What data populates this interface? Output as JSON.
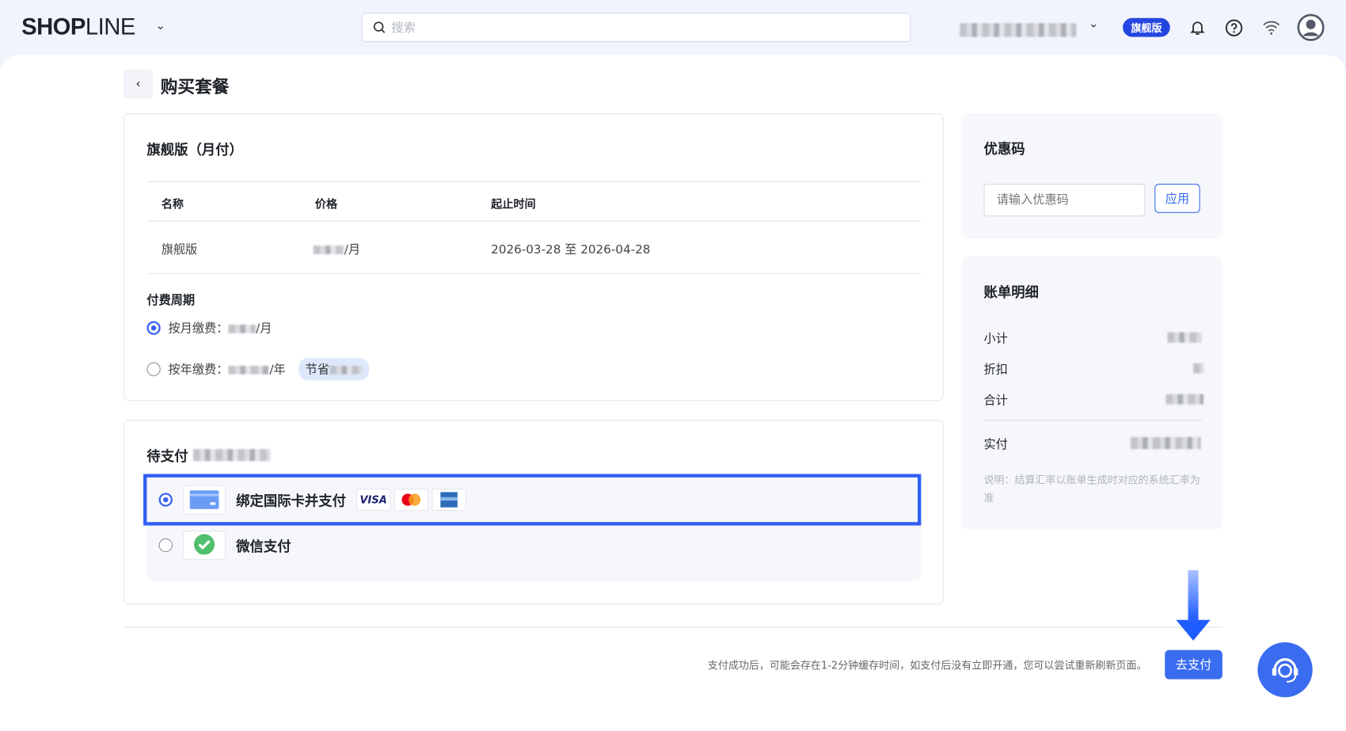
{
  "header": {
    "logo": {
      "bold": "SHOP",
      "thin": "LINE"
    },
    "search_placeholder": "搜索",
    "plan_badge": "旗舰版"
  },
  "page": {
    "title": "购买套餐"
  },
  "plan_card": {
    "title": "旗舰版（月付）",
    "columns": [
      "名称",
      "价格",
      "起止时间"
    ],
    "row": {
      "name": "旗舰版",
      "price_suffix": "/月",
      "period": "2026-03-28 至 2026-04-28"
    },
    "billing_cycle_label": "付费周期",
    "options": [
      {
        "label": "按月缴费：",
        "suffix": "/月",
        "selected": true
      },
      {
        "label": "按年缴费：",
        "suffix": "/年",
        "selected": false,
        "save_tag": "节省"
      }
    ]
  },
  "payment_card": {
    "title": "待支付",
    "methods": [
      {
        "label": "绑定国际卡并支付",
        "selected": true,
        "brands": [
          "VISA",
          "mastercard",
          "amex"
        ]
      },
      {
        "label": "微信支付",
        "selected": false
      }
    ]
  },
  "coupon": {
    "title": "优惠码",
    "placeholder": "请输入优惠码",
    "apply": "应用"
  },
  "bill": {
    "title": "账单明细",
    "items": [
      "小计",
      "折扣",
      "合计"
    ],
    "paid": "实付",
    "note": "说明：结算汇率以账单生成时对应的系统汇率为准"
  },
  "footer": {
    "notice": "支付成功后，可能会存在1-2分钟缓存时间，如支付后没有立即开通，您可以尝试重新刷新页面。",
    "pay_button": "去支付"
  },
  "colors": {
    "accent": "#3a6cf0",
    "highlight": "#2f5ff5",
    "badge": "#2446e0"
  }
}
